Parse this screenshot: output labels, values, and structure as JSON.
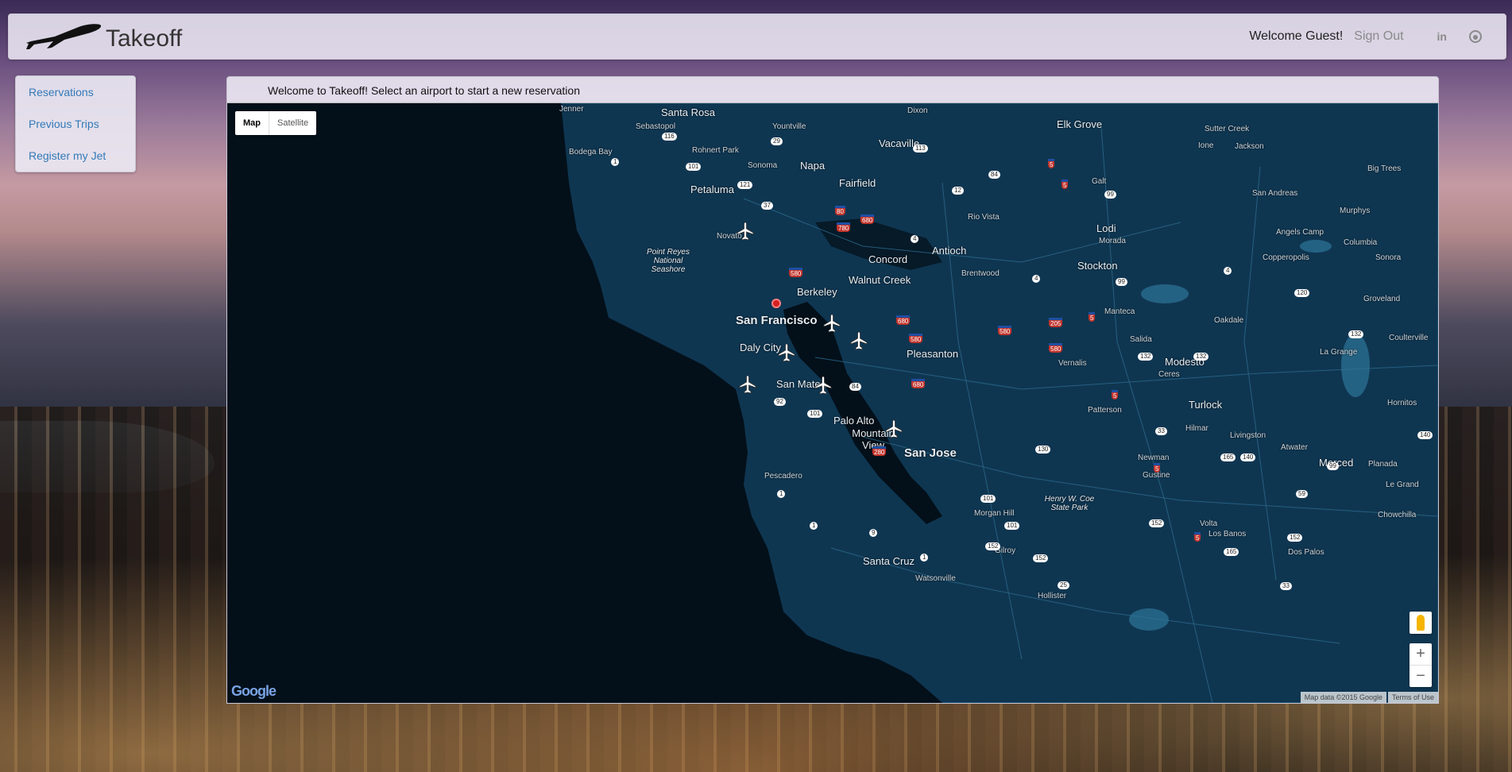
{
  "header": {
    "brand": "Takeoff",
    "welcome": "Welcome Guest!",
    "sign_out": "Sign Out",
    "linkedin_label": "in"
  },
  "sidebar": {
    "items": [
      {
        "label": "Reservations"
      },
      {
        "label": "Previous Trips"
      },
      {
        "label": "Register my Jet"
      }
    ]
  },
  "panel": {
    "heading": "Welcome to Takeoff! Select an airport to start a new reservation"
  },
  "map": {
    "type_controls": {
      "map": "Map",
      "satellite": "Satellite"
    },
    "zoom_in": "+",
    "zoom_out": "−",
    "logo": "Google",
    "attribution": "Map data ©2015 Google",
    "terms": "Terms of Use",
    "labels": {
      "jenner": "Jenner",
      "santa_rosa": "Santa Rosa",
      "sebastopol": "Sebastopol",
      "rohnert_park": "Rohnert Park",
      "bodega_bay": "Bodega Bay",
      "yountville": "Yountville",
      "sonoma": "Sonoma",
      "napa": "Napa",
      "petaluma": "Petaluma",
      "novato": "Novato",
      "point_reyes": "Point Reyes National Seashore",
      "dixon": "Dixon",
      "vacaville": "Vacaville",
      "fairfield": "Fairfield",
      "rio_vista": "Rio Vista",
      "elk_grove": "Elk Grove",
      "galt": "Galt",
      "lodi": "Lodi",
      "sutter_creek": "Sutter Creek",
      "ione": "Ione",
      "jackson": "Jackson",
      "san_andreas": "San Andreas",
      "big_trees": "Big Trees",
      "murphys": "Murphys",
      "angels_camp": "Angels Camp",
      "columbia": "Columbia",
      "copperopolis": "Copperopolis",
      "sonora": "Sonora",
      "morada": "Morada",
      "stockton": "Stockton",
      "antioch": "Antioch",
      "concord": "Concord",
      "brentwood": "Brentwood",
      "walnut_creek": "Walnut Creek",
      "berkeley": "Berkeley",
      "san_francisco": "San Francisco",
      "daly_city": "Daly City",
      "pleasanton": "Pleasanton",
      "manteca": "Manteca",
      "salida": "Salida",
      "oakdale": "Oakdale",
      "groveland": "Groveland",
      "coulterville": "Coulterville",
      "la_grange": "La Grange",
      "vernalis": "Vernalis",
      "modesto": "Modesto",
      "ceres": "Ceres",
      "san_mateo": "San Mateo",
      "palo_alto": "Palo Alto",
      "mountain_view": "Mountain View",
      "san_jose": "San Jose",
      "patterson": "Patterson",
      "turlock": "Turlock",
      "hilmar": "Hilmar",
      "livingston": "Livingston",
      "atwater": "Atwater",
      "merced": "Merced",
      "planada": "Planada",
      "hornitos": "Hornitos",
      "newman": "Newman",
      "gustine": "Gustine",
      "le_grand": "Le Grand",
      "pescadero": "Pescadero",
      "henry_coe": "Henry W. Coe State Park",
      "morgan_hill": "Morgan Hill",
      "gilroy": "Gilroy",
      "santa_cruz": "Santa Cruz",
      "watsonville": "Watsonville",
      "hollister": "Hollister",
      "volta": "Volta",
      "los_banos": "Los Banos",
      "dos_palos": "Dos Palos",
      "chowchilla": "Chowchilla"
    }
  }
}
